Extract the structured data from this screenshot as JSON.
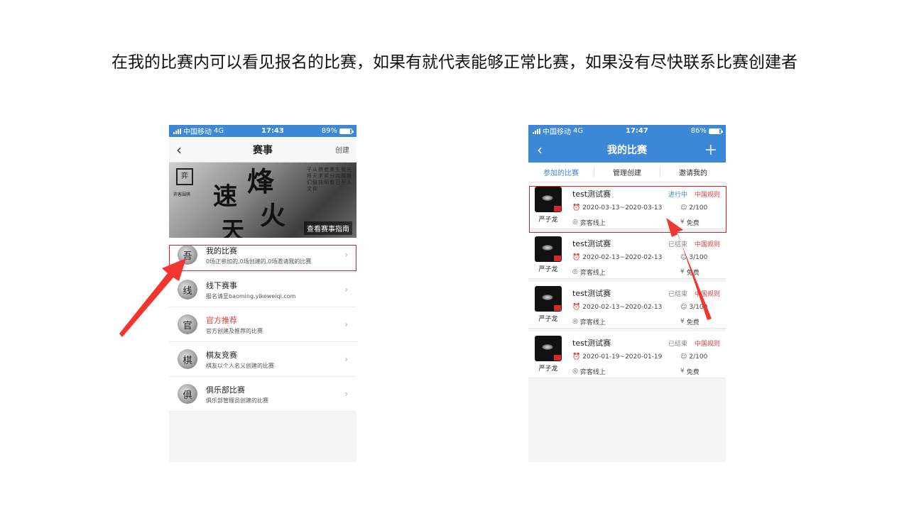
{
  "caption": "在我的比赛内可以看见报名的比赛，如果有就代表能够正常比赛，如果没有尽快联系比赛创建者",
  "colors": {
    "accent": "#3d88d6",
    "highlight": "#d7242c",
    "arrow": "#f2352f"
  },
  "phone1": {
    "status": {
      "carrier": "中国移动",
      "network": "4G",
      "time": "17:43",
      "battery": "89%",
      "battery_level": 0.89
    },
    "nav": {
      "back_icon": "chevron-left-icon",
      "title": "赛事",
      "action": "创建"
    },
    "banner": {
      "guide": "查看赛事指南"
    },
    "menu": [
      {
        "icon": "吾",
        "title": "我的比赛",
        "sub": "0场正参加的,0场创建的,0场邀请我的比赛",
        "red": false
      },
      {
        "icon": "线",
        "title": "线下赛事",
        "sub": "报名请至baoming.yikeweiqi.com",
        "red": false
      },
      {
        "icon": "官",
        "title": "官方推荐",
        "sub": "官方创建及推荐的比赛",
        "red": true
      },
      {
        "icon": "棋",
        "title": "棋友竞赛",
        "sub": "棋友以个人名义创建的比赛",
        "red": false
      },
      {
        "icon": "俱",
        "title": "俱乐部比赛",
        "sub": "俱乐部管理员创建的比赛",
        "red": false
      }
    ]
  },
  "phone2": {
    "status": {
      "carrier": "中国移动",
      "network": "4G",
      "time": "17:47",
      "battery": "86%",
      "battery_level": 0.86
    },
    "nav": {
      "title": "我的比赛",
      "action_icon": "plus-icon"
    },
    "tabs": [
      {
        "label": "参加的比赛",
        "active": true
      },
      {
        "label": "管理创建",
        "active": false
      },
      {
        "label": "邀请我的",
        "active": false
      }
    ],
    "cards": [
      {
        "title": "test测试赛",
        "status": "进行中",
        "live": true,
        "rule": "中国规则",
        "dates": "2020-03-13~2020-03-13",
        "players": "2/100",
        "place": "弈客线上",
        "fee": "免费",
        "owner": "严子龙"
      },
      {
        "title": "test测试赛",
        "status": "已结束",
        "live": false,
        "rule": "中国规则",
        "dates": "2020-02-13~2020-02-13",
        "players": "3/100",
        "place": "弈客线上",
        "fee": "免费",
        "owner": "严子龙"
      },
      {
        "title": "test测试赛",
        "status": "已结束",
        "live": false,
        "rule": "中国规则",
        "dates": "2020-02-13~2020-02-13",
        "players": "3/100",
        "place": "弈客线上",
        "fee": "免费",
        "owner": "严子龙"
      },
      {
        "title": "test测试赛",
        "status": "已结束",
        "live": false,
        "rule": "中国规则",
        "dates": "2020-01-19~2020-01-19",
        "players": "2/100",
        "place": "弈客线上",
        "fee": "免费",
        "owner": "严子龙"
      }
    ]
  }
}
